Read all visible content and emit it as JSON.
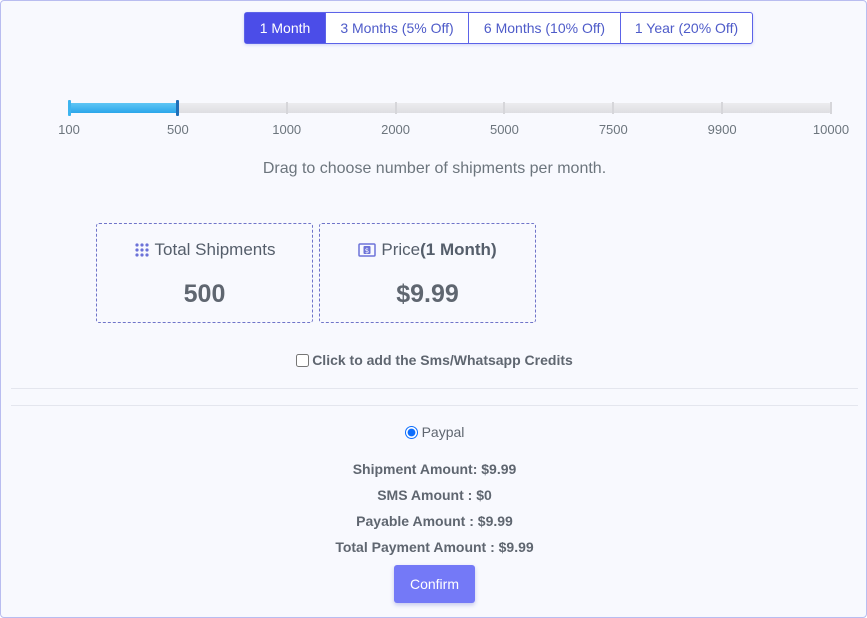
{
  "plans": [
    {
      "label": "1 Month",
      "active": true
    },
    {
      "label": "3 Months (5% Off)",
      "active": false
    },
    {
      "label": "6 Months (10% Off)",
      "active": false
    },
    {
      "label": "1 Year (20% Off)",
      "active": false
    }
  ],
  "slider": {
    "ticks": [
      "100",
      "500",
      "1000",
      "2000",
      "5000",
      "7500",
      "9900",
      "10000"
    ],
    "selected_index": 1
  },
  "hint": "Drag to choose number of shipments per month.",
  "cards": {
    "shipments": {
      "title": "Total Shipments",
      "value": "500",
      "icon": "grid-dots-icon"
    },
    "price": {
      "title_prefix": "Price",
      "title_suffix": "(1 Month)",
      "value": "$9.99",
      "icon": "money-bill-icon"
    }
  },
  "sms_checkbox": {
    "label": "Click to add the Sms/Whatsapp Credits",
    "checked": false
  },
  "payment": {
    "method": "Paypal",
    "selected": true
  },
  "summary": [
    "Shipment Amount: $9.99",
    "SMS Amount : $0",
    "Payable Amount : $9.99",
    "Total Payment Amount : $9.99"
  ],
  "confirm_label": "Confirm",
  "colors": {
    "accent": "#4b4de8",
    "slider_fill": "#2ba6ea",
    "confirm": "#7479f7"
  }
}
